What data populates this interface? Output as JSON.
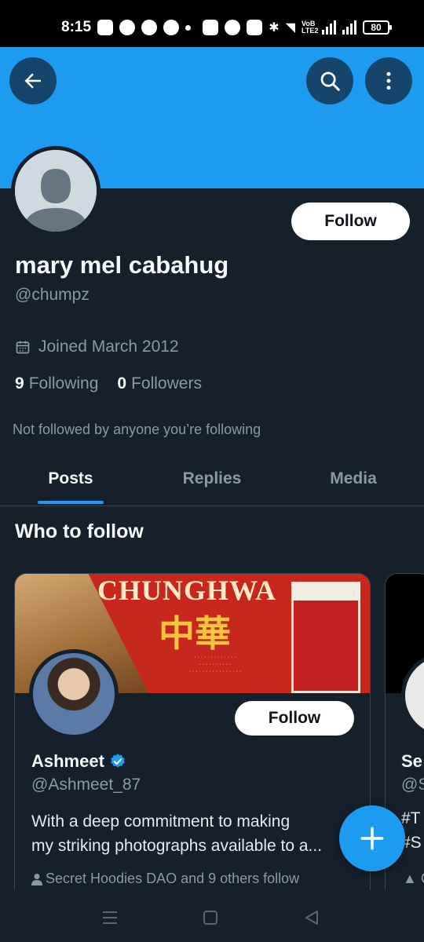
{
  "status_bar": {
    "time": "8:15",
    "network_label": "VoB LTE2",
    "battery": "80"
  },
  "profile": {
    "name": "mary mel cabahug",
    "handle": "@chumpz",
    "joined": "Joined March 2012",
    "following_count": "9",
    "following_label": "Following",
    "followers_count": "0",
    "followers_label": "Followers",
    "not_followed_text": "Not followed by anyone you’re following",
    "follow_label": "Follow"
  },
  "colors": {
    "accent": "#1d9bf0",
    "background": "#15202b",
    "muted_text": "#8b98a5"
  },
  "tabs": [
    {
      "label": "Posts",
      "active": true
    },
    {
      "label": "Replies",
      "active": false
    },
    {
      "label": "Media",
      "active": false
    }
  ],
  "who_to_follow": {
    "title": "Who to follow",
    "cards": [
      {
        "banner_title": "CHUNGHWA",
        "banner_chinese": "中華",
        "name": "Ashmeet",
        "verified": true,
        "handle": "@Ashmeet_87",
        "bio_line1": "With a deep commitment to making",
        "bio_line2": "my striking photographs available to a...",
        "social_proof": "Secret Hoodies DAO and 9 others follow",
        "follow_label": "Follow"
      },
      {
        "name": "Se",
        "handle": "@S",
        "bio_line1": "#T",
        "bio_line2": "#S",
        "social_proof": "C"
      }
    ]
  }
}
